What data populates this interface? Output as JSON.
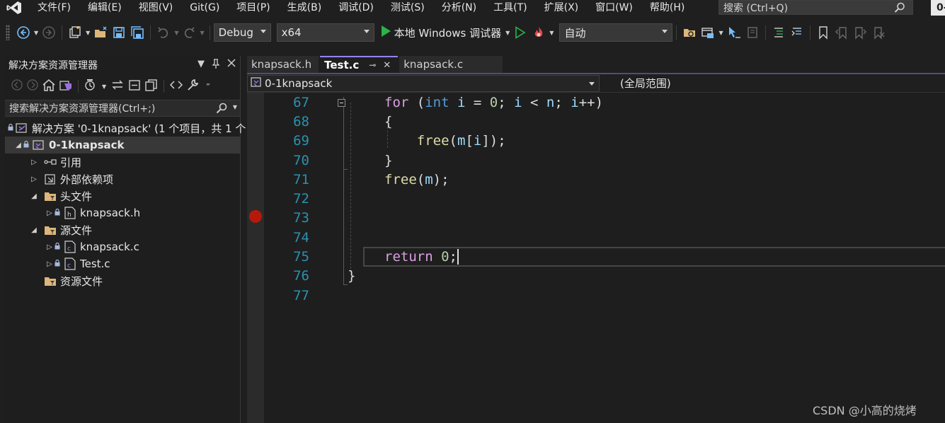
{
  "menubar": {
    "items": [
      "文件(F)",
      "编辑(E)",
      "视图(V)",
      "Git(G)",
      "项目(P)",
      "生成(B)",
      "调试(D)",
      "测试(S)",
      "分析(N)",
      "工具(T)",
      "扩展(X)",
      "窗口(W)",
      "帮助(H)"
    ],
    "search_placeholder": "搜索 (Ctrl+Q)",
    "profile_badge": "0-"
  },
  "toolbar": {
    "config": "Debug",
    "platform": "x64",
    "run_label": "本地 Windows 调试器",
    "mode": "自动"
  },
  "solution_explorer": {
    "title": "解决方案资源管理器",
    "search_placeholder": "搜索解决方案资源管理器(Ctrl+;)",
    "tree": [
      {
        "label": "解决方案 '0-1knapsack' (1 个项目，共 1 个",
        "icon": "solution-icon",
        "indent": 0,
        "expander": "",
        "lock": true
      },
      {
        "label": "0-1knapsack",
        "icon": "project-icon",
        "indent": 1,
        "expander": "◢",
        "lock": true,
        "selected": true
      },
      {
        "label": "引用",
        "icon": "references-icon",
        "indent": 2,
        "expander": "▷",
        "lock": false
      },
      {
        "label": "外部依赖项",
        "icon": "external-deps-icon",
        "indent": 2,
        "expander": "▷",
        "lock": false
      },
      {
        "label": "头文件",
        "icon": "folder-filter-icon",
        "indent": 2,
        "expander": "◢",
        "lock": false
      },
      {
        "label": "knapsack.h",
        "icon": "header-file-icon",
        "indent": 3,
        "expander": "▷",
        "lock": true
      },
      {
        "label": "源文件",
        "icon": "folder-filter-icon",
        "indent": 2,
        "expander": "◢",
        "lock": false
      },
      {
        "label": "knapsack.c",
        "icon": "c-file-icon",
        "indent": 3,
        "expander": "▷",
        "lock": true
      },
      {
        "label": "Test.c",
        "icon": "c-file-icon",
        "indent": 3,
        "expander": "▷",
        "lock": true
      },
      {
        "label": "资源文件",
        "icon": "folder-filter-icon",
        "indent": 2,
        "expander": "",
        "lock": false
      }
    ]
  },
  "editor": {
    "tabs": [
      {
        "label": "knapsack.h",
        "active": false
      },
      {
        "label": "Test.c",
        "active": true
      },
      {
        "label": "knapsack.c",
        "active": false
      }
    ],
    "nav_project": "0-1knapsack",
    "nav_scope": "(全局范围)",
    "breakpoint_line": 73,
    "current_line": 75,
    "lines": [
      {
        "num": "67",
        "tokens": [
          [
            "ctl",
            "for"
          ],
          [
            "plain",
            " ("
          ],
          [
            "kw",
            "int"
          ],
          [
            "plain",
            " "
          ],
          [
            "var",
            "i"
          ],
          [
            "plain",
            " = "
          ],
          [
            "num",
            "0"
          ],
          [
            "plain",
            "; "
          ],
          [
            "var",
            "i"
          ],
          [
            "plain",
            " < "
          ],
          [
            "var",
            "n"
          ],
          [
            "plain",
            "; "
          ],
          [
            "var",
            "i"
          ],
          [
            "plain",
            "++)"
          ]
        ],
        "fold": "minus"
      },
      {
        "num": "68",
        "tokens": [
          [
            "plain",
            "{"
          ]
        ]
      },
      {
        "num": "69",
        "tokens": [
          [
            "plain",
            "    "
          ],
          [
            "fn",
            "free"
          ],
          [
            "plain",
            "("
          ],
          [
            "var",
            "m"
          ],
          [
            "plain",
            "["
          ],
          [
            "var",
            "i"
          ],
          [
            "plain",
            "]);"
          ]
        ]
      },
      {
        "num": "70",
        "tokens": [
          [
            "plain",
            "}"
          ]
        ]
      },
      {
        "num": "71",
        "tokens": [
          [
            "fn",
            "free"
          ],
          [
            "plain",
            "("
          ],
          [
            "var",
            "m"
          ],
          [
            "plain",
            ");"
          ]
        ]
      },
      {
        "num": "72",
        "tokens": []
      },
      {
        "num": "73",
        "tokens": []
      },
      {
        "num": "74",
        "tokens": []
      },
      {
        "num": "75",
        "tokens": [
          [
            "ctl",
            "return"
          ],
          [
            "plain",
            " "
          ],
          [
            "num",
            "0"
          ],
          [
            "plain",
            ";"
          ]
        ]
      },
      {
        "num": "76",
        "tokens": [
          [
            "plain",
            "}"
          ]
        ]
      },
      {
        "num": "77",
        "tokens": []
      }
    ]
  },
  "watermark": "CSDN @小高的烧烤"
}
